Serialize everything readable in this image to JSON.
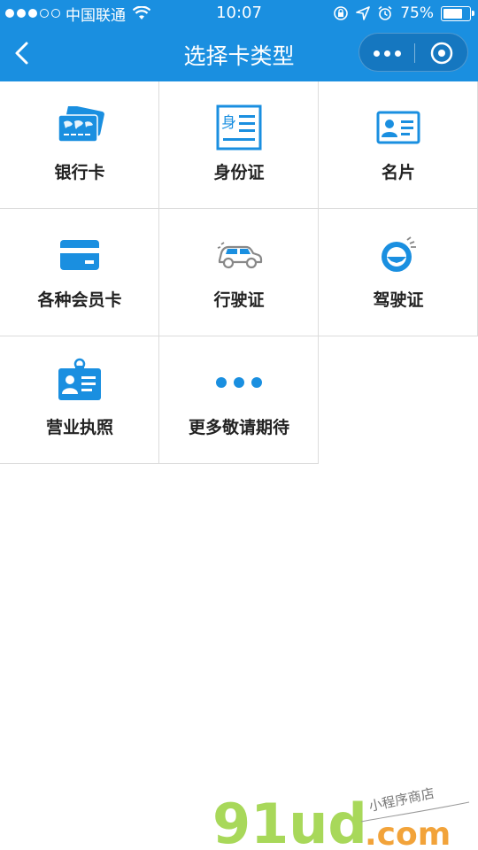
{
  "status_bar": {
    "carrier": "中国联通",
    "time": "10:07",
    "battery": "75%",
    "battery_level": 0.75
  },
  "nav": {
    "title": "选择卡类型"
  },
  "cards": [
    {
      "label": "银行卡",
      "icon": "bank-card-icon"
    },
    {
      "label": "身份证",
      "icon": "id-card-icon"
    },
    {
      "label": "名片",
      "icon": "business-card-icon"
    },
    {
      "label": "各种会员卡",
      "icon": "member-card-icon"
    },
    {
      "label": "行驶证",
      "icon": "car-icon"
    },
    {
      "label": "驾驶证",
      "icon": "steering-wheel-icon"
    },
    {
      "label": "营业执照",
      "icon": "business-license-icon"
    },
    {
      "label": "更多敬请期待",
      "icon": "more-dots-icon"
    }
  ],
  "watermark": {
    "brand": "91ud",
    "domain": ".com",
    "tagline": "小程序商店"
  },
  "colors": {
    "primary": "#1a8fe0",
    "icon": "#1a8fe0",
    "border": "#dcdcdc"
  }
}
